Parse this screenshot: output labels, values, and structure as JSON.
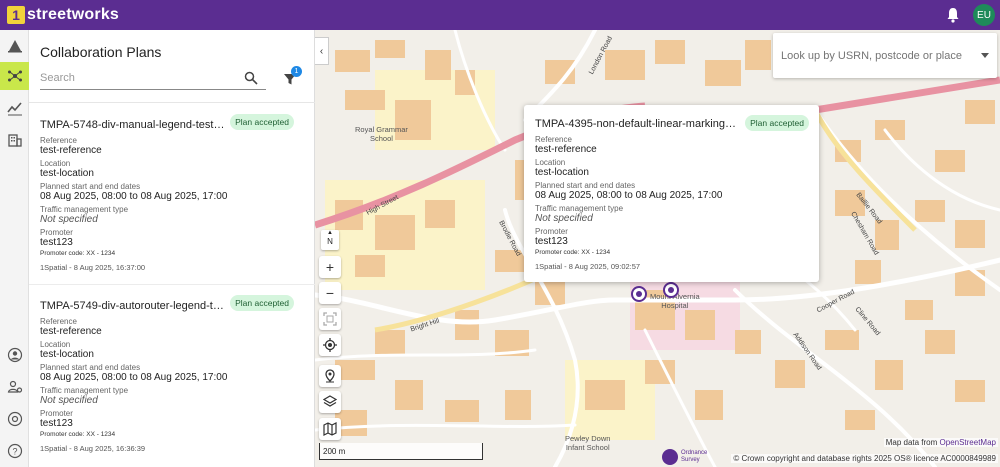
{
  "header": {
    "logo_mark": "1",
    "logo_text": "streetworks",
    "avatar_initials": "EU"
  },
  "panel": {
    "title": "Collaboration Plans",
    "search_placeholder": "Search",
    "filter_count": "1"
  },
  "labels": {
    "reference": "Reference",
    "location": "Location",
    "dates": "Planned start and end dates",
    "traffic": "Traffic management type",
    "promoter": "Promoter"
  },
  "plans": [
    {
      "title": "TMPA-5748-div-manual-legend-test-2...",
      "status": "Plan accepted",
      "reference": "test-reference",
      "location": "test-location",
      "dates": "08 Aug 2025, 08:00 to 08 Aug 2025, 17:00",
      "traffic": "Not specified",
      "promoter": "test123",
      "promoter_code": "Promoter code: XX - 1234",
      "footer": "1Spatial - 8 Aug 2025, 16:37:00"
    },
    {
      "title": "TMPA-5749-div-autorouter-legend-tes...",
      "status": "Plan accepted",
      "reference": "test-reference",
      "location": "test-location",
      "dates": "08 Aug 2025, 08:00 to 08 Aug 2025, 17:00",
      "traffic": "Not specified",
      "promoter": "test123",
      "promoter_code": "Promoter code: XX - 1234",
      "footer": "1Spatial - 8 Aug 2025, 16:36:39"
    }
  ],
  "popup": {
    "title": "TMPA-4395-non-default-linear-markings-t...",
    "status": "Plan accepted",
    "reference": "test-reference",
    "location": "test-location",
    "dates": "08 Aug 2025, 08:00 to 08 Aug 2025, 17:00",
    "traffic": "Not specified",
    "promoter": "test123",
    "promoter_code": "Promoter code: XX - 1234",
    "footer": "1Spatial - 8 Aug 2025, 09:02:57"
  },
  "map": {
    "lookup_placeholder": "Look up by USRN, postcode or place",
    "north": "N",
    "zoom_in": "+",
    "zoom_out": "−",
    "scale": "200 m",
    "attribution_prefix": "Map data from",
    "attribution_link": "OpenStreetMap",
    "copyright": "© Crown copyright and database rights 2025 OS® licence AC0000849989",
    "os_name_1": "Ordnance",
    "os_name_2": "Survey",
    "places": {
      "school1_line1": "Royal Grammar",
      "school1_line2": "School",
      "hospital_line1": "Mount Alvernia",
      "hospital_line2": "Hospital",
      "school2_line1": "Pewley Down",
      "school2_line2": "Infant School"
    },
    "streets": {
      "high_street": "High Street",
      "london_road": "London Road",
      "bright_hill": "Bright Hill",
      "brodie_road": "Brodie Road",
      "cooper_road": "Cooper Road",
      "addison_road": "Addison Road",
      "clinic_road": "Cline Road",
      "baillie_road": "Baillie Road",
      "chesham_road": "Chesham Road"
    }
  },
  "colors": {
    "brand": "#5b2d91",
    "rail_active": "#c9e74a",
    "badge_bg": "#d5f5dd",
    "avatar": "#1e8a5a"
  }
}
